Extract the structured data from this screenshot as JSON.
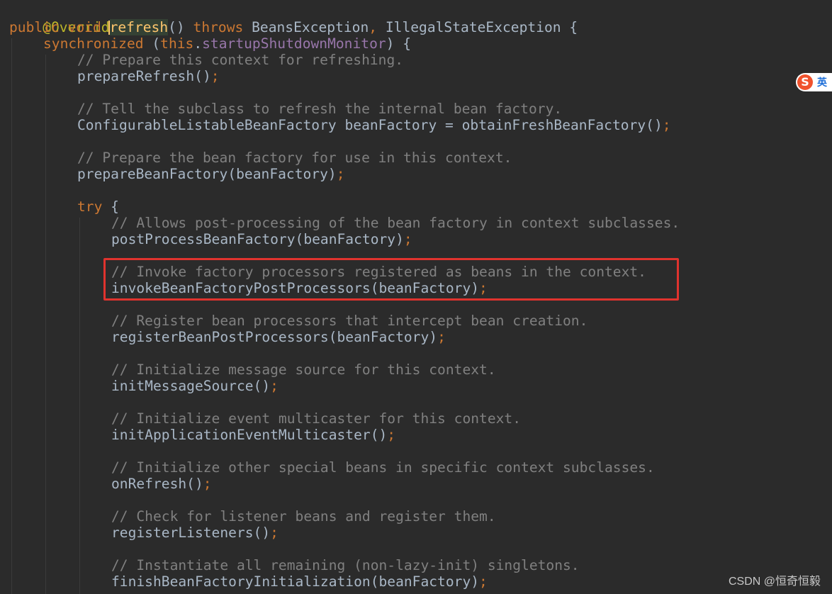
{
  "code": {
    "l1": "@Override",
    "l2": {
      "mods": "public void ",
      "method": "refresh",
      "parens": "() ",
      "throws": "throws",
      "exc1": " BeansException",
      "comma": ",",
      "exc2": " IllegalStateException {"
    },
    "l3": {
      "sync": "synchronized",
      "open": " (",
      "self": "this",
      "dot": ".",
      "field": "startupShutdownMonitor",
      "close": ") {"
    },
    "l4": "// Prepare this context for refreshing.",
    "l5": "prepareRefresh()",
    "l7": "// Tell the subclass to refresh the internal bean factory.",
    "l8": "ConfigurableListableBeanFactory beanFactory = obtainFreshBeanFactory()",
    "l10": "// Prepare the bean factory for use in this context.",
    "l11": "prepareBeanFactory(beanFactory)",
    "l13": {
      "kw": "try",
      "rest": " {"
    },
    "l14": "// Allows post-processing of the bean factory in context subclasses.",
    "l15": "postProcessBeanFactory(beanFactory)",
    "l17": "// Invoke factory processors registered as beans in the context.",
    "l18": "invokeBeanFactoryPostProcessors(beanFactory)",
    "l20": "// Register bean processors that intercept bean creation.",
    "l21": "registerBeanPostProcessors(beanFactory)",
    "l23": "// Initialize message source for this context.",
    "l24": "initMessageSource()",
    "l26": "// Initialize event multicaster for this context.",
    "l27": "initApplicationEventMulticaster()",
    "l29": "// Initialize other special beans in specific context subclasses.",
    "l30": "onRefresh()",
    "l32": "// Check for listener beans and register them.",
    "l33": "registerListeners()",
    "l35": "// Instantiate all remaining (non-lazy-init) singletons.",
    "l36": "finishBeanFactoryInitialization(beanFactory)",
    "semi": ";"
  },
  "ime": {
    "logo": "S",
    "lang": "英"
  },
  "watermark": "CSDN @恒奇恒毅",
  "colors": {
    "background": "#2b2b2b",
    "keyword": "#cc7832",
    "annotation": "#bbb529",
    "method_decl": "#ffc66d",
    "field": "#9876aa",
    "comment": "#808080",
    "default_text": "#a9b7c6",
    "highlight_box": "#e0332e"
  }
}
